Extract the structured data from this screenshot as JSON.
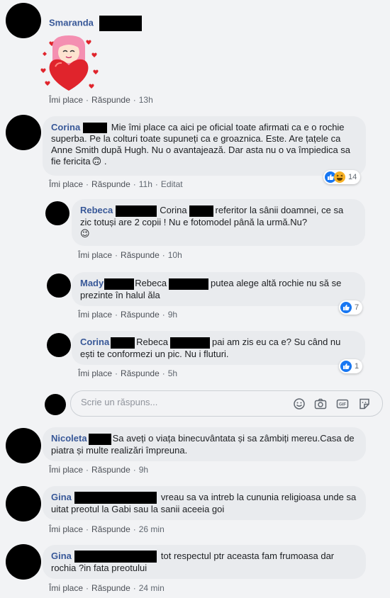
{
  "actions": {
    "like": "Îmi place",
    "reply": "Răspunde",
    "dot": "·",
    "edited": "Editat"
  },
  "comments": [
    {
      "author": "Smaranda",
      "text": "",
      "time": "13h",
      "sticker": "heart-hug-sticker"
    },
    {
      "author": "Corina",
      "text": " Mie îmi place ca aici pe oficial toate afirmati ca e o rochie superba. Pe la colturi toate supuneți ca e groaznica. Este. Are țațele ca Anne Smith după Hugh. Nu o avantajează. Dar asta nu o va împiedica sa fie fericita",
      "emoji": "🙃",
      "time": "11h",
      "edited": true,
      "reactions": {
        "types": [
          "like",
          "haha"
        ],
        "count": "14"
      }
    },
    {
      "author": "Nicoleta",
      "text": "Sa aveți o viața binecuvântata și sa zâmbiți mereu.Casa de piatra și multe realizări împreuna.",
      "time": "9h"
    },
    {
      "author": "Gina",
      "text": "vreau sa va intreb la cununia religioasa unde sa uitat preotul la Gabi sau la sanii aceeia goi",
      "time": "26 min"
    },
    {
      "author": "Gina",
      "text": "tot respectul ptr aceasta fam frumoasa dar rochia ?in fata preotului",
      "time": "24 min"
    }
  ],
  "replies": [
    {
      "author": "Rebeca",
      "mention": "Corina",
      "text": "referitor la sânii doamnei, ce sa zic totuși are 2 copii ! Nu e fotomodel până la urmă.Nu?",
      "emoji": "😉",
      "time": "10h"
    },
    {
      "author": "Mady",
      "mention": "Rebeca",
      "text": "putea alege altă rochie nu să se prezinte în halul ăla",
      "time": "9h",
      "reactions": {
        "types": [
          "like"
        ],
        "count": "7"
      }
    },
    {
      "author": "Corina",
      "mention": "Rebeca",
      "text": "pai am zis eu ca e? Su când nu ești te conformezi un pic. Nu i fluturi.",
      "time": "5h",
      "reactions": {
        "types": [
          "like"
        ],
        "count": "1"
      }
    }
  ],
  "reply_input": {
    "placeholder": "Scrie un răspuns...",
    "icons": [
      "emoji-icon",
      "camera-icon",
      "gif-icon",
      "sticker-icon"
    ]
  },
  "colors": {
    "name": "#385898",
    "bubble": "#e9ebee",
    "background": "#f2f3f5",
    "like": "#1877f2"
  }
}
